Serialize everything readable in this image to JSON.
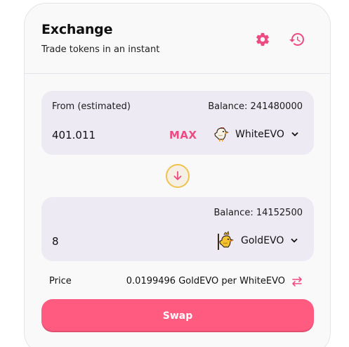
{
  "header": {
    "title": "Exchange",
    "subtitle": "Trade tokens in an instant",
    "settings_icon": "gear-icon",
    "history_icon": "history-icon"
  },
  "from": {
    "label": "From (estimated)",
    "balance": "Balance: 241480000",
    "amount": "401.011",
    "max_label": "MAX",
    "token": "WhiteEVO"
  },
  "to": {
    "balance": "Balance: 14152500",
    "amount": "8",
    "token": "GoldEVO"
  },
  "price": {
    "label": "Price",
    "value": "0.0199496 GoldEVO per WhiteEVO"
  },
  "swap": {
    "label": "Swap"
  },
  "colors": {
    "accent": "#ed4b82",
    "swap_button": "#ff5a80",
    "panel": "#eeeaf4",
    "arrow_border": "#f0c24f"
  }
}
